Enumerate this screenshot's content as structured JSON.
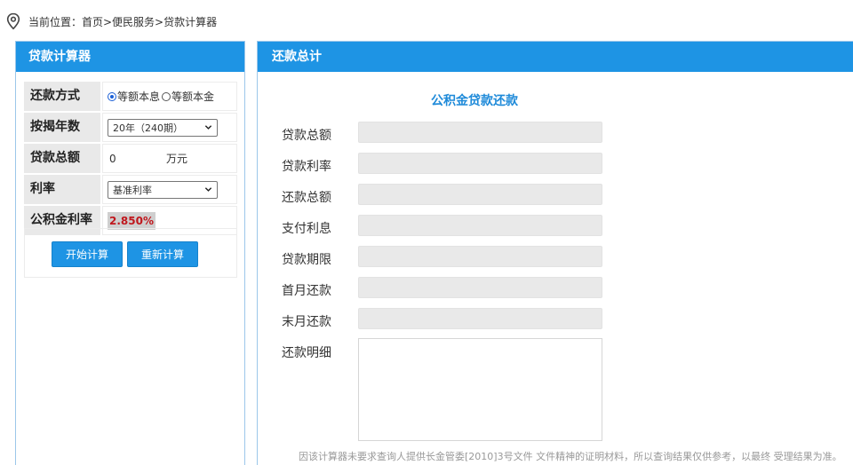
{
  "breadcrumb": {
    "icon": "location-pin-icon",
    "text": "当前位置：首页>便民服务>贷款计算器"
  },
  "calculator": {
    "header": "贷款计算器",
    "rows": {
      "repay_method": {
        "label": "还款方式",
        "options": [
          "等额本息",
          "等额本金"
        ],
        "selected": "等额本息"
      },
      "years": {
        "label": "按揭年数",
        "value": "20年（240期）"
      },
      "amount": {
        "label": "贷款总额",
        "value": "0",
        "unit": "万元"
      },
      "rate": {
        "label": "利率",
        "value": "基准利率"
      },
      "fund_rate": {
        "label": "公积金利率",
        "value": "2.850%"
      }
    },
    "buttons": {
      "calc": "开始计算",
      "reset": "重新计算"
    }
  },
  "result": {
    "header": "还款总计",
    "title": "公积金贷款还款",
    "fields": [
      {
        "label": "贷款总额",
        "value": ""
      },
      {
        "label": "贷款利率",
        "value": ""
      },
      {
        "label": "还款总额",
        "value": ""
      },
      {
        "label": "支付利息",
        "value": ""
      },
      {
        "label": "贷款期限",
        "value": ""
      },
      {
        "label": "首月还款",
        "value": ""
      },
      {
        "label": "末月还款",
        "value": ""
      }
    ],
    "detail_label": "还款明细",
    "footnote": "因该计算器未要求查询人提供长金管委[2010]3号文件 文件精神的证明材料，所以查询结果仅供参考，以最终 受理结果为准。"
  },
  "colors": {
    "accent": "#1e94e4",
    "rate_text": "#c0171d",
    "label_bg": "#e9e9e9"
  }
}
